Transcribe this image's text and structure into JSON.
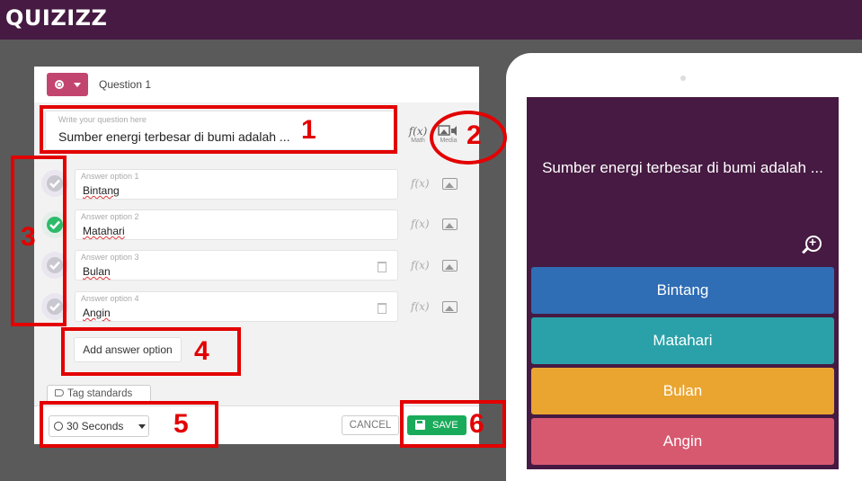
{
  "app": {
    "logo_text": "QUIZIZZ"
  },
  "editor": {
    "question_label": "Question 1",
    "question_placeholder": "Write your question here",
    "question_text": "Sumber energi terbesar di bumi adalah ...",
    "tools": {
      "math_label": "Math",
      "media_label": "Media",
      "math_symbol": "f(x)"
    },
    "answers": [
      {
        "placeholder": "Answer option 1",
        "value": "Bintang",
        "correct": false
      },
      {
        "placeholder": "Answer option 2",
        "value": "Matahari",
        "correct": true
      },
      {
        "placeholder": "Answer option 3",
        "value": "Bulan",
        "correct": false
      },
      {
        "placeholder": "Answer option 4",
        "value": "Angin",
        "correct": false
      }
    ],
    "add_answer_label": "Add answer option",
    "tag_standards_label": "Tag standards",
    "timer_value": "30 Seconds",
    "cancel_label": "CANCEL",
    "save_label": "SAVE"
  },
  "preview": {
    "question_text": "Sumber energi terbesar di bumi adalah ...",
    "options": [
      {
        "label": "Bintang",
        "color": "#2f6db5"
      },
      {
        "label": "Matahari",
        "color": "#2aa1a9"
      },
      {
        "label": "Bulan",
        "color": "#eaa531"
      },
      {
        "label": "Angin",
        "color": "#d75970"
      }
    ]
  },
  "annotations": {
    "markers": [
      "1",
      "2",
      "3",
      "4",
      "5",
      "6"
    ],
    "color": "#e30000"
  },
  "colors": {
    "topbar": "#461a42",
    "accent": "#c2456f",
    "save": "#1aab5a",
    "correct": "#2dbb6a"
  }
}
